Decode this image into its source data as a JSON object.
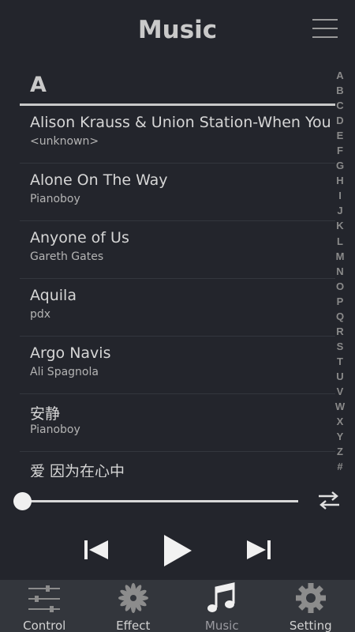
{
  "header": {
    "title": "Music",
    "menu_icon": "hamburger-menu-icon"
  },
  "section": {
    "letter": "A"
  },
  "songs": [
    {
      "title": "Alison Krauss & Union Station-When You",
      "artist": "<unknown>"
    },
    {
      "title": "Alone On The Way",
      "artist": "Pianoboy"
    },
    {
      "title": "Anyone of Us",
      "artist": "Gareth Gates"
    },
    {
      "title": "Aquila",
      "artist": "pdx"
    },
    {
      "title": "Argo Navis",
      "artist": "Ali Spagnola"
    },
    {
      "title": "安静",
      "artist": "Pianoboy"
    },
    {
      "title": "爱 因为在心中",
      "artist": ""
    }
  ],
  "index": [
    "A",
    "B",
    "C",
    "D",
    "E",
    "F",
    "G",
    "H",
    "I",
    "J",
    "K",
    "L",
    "M",
    "N",
    "O",
    "P",
    "Q",
    "R",
    "S",
    "T",
    "U",
    "V",
    "W",
    "X",
    "Y",
    "Z",
    "#"
  ],
  "player": {
    "progress": 0.0
  },
  "tabs": [
    {
      "label": "Control",
      "icon": "sliders-icon"
    },
    {
      "label": "Effect",
      "icon": "flower-icon"
    },
    {
      "label": "Music",
      "icon": "music-note-icon",
      "active": true
    },
    {
      "label": "Setting",
      "icon": "gear-icon"
    }
  ],
  "colors": {
    "background": "#23252c",
    "tabbar": "#33363c",
    "text": "#d6d6d6"
  }
}
